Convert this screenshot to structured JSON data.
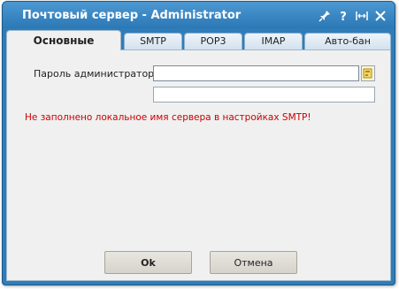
{
  "window": {
    "title": "Почтовый сервер - Administrator",
    "controls": [
      "pin-icon",
      "help-icon",
      "restore-icon",
      "close-icon"
    ]
  },
  "tabs": [
    {
      "label": "Основные",
      "active": true
    },
    {
      "label": "SMTP",
      "active": false
    },
    {
      "label": "POP3",
      "active": false
    },
    {
      "label": "IMAP",
      "active": false
    },
    {
      "label": "Авто-бан",
      "active": false
    }
  ],
  "form": {
    "password_label": "Пароль администратора",
    "password_value": "",
    "password_confirm_value": "",
    "generate_icon": "key-generate-icon"
  },
  "error_message": "Не заполнено локальное имя сервера в настройках SMTP!",
  "buttons": {
    "ok_label": "Ok",
    "cancel_label": "Отмена"
  },
  "colors": {
    "titlebar": "#2f7db8",
    "error": "#cc0000",
    "content_bg": "#f0f0f0"
  }
}
